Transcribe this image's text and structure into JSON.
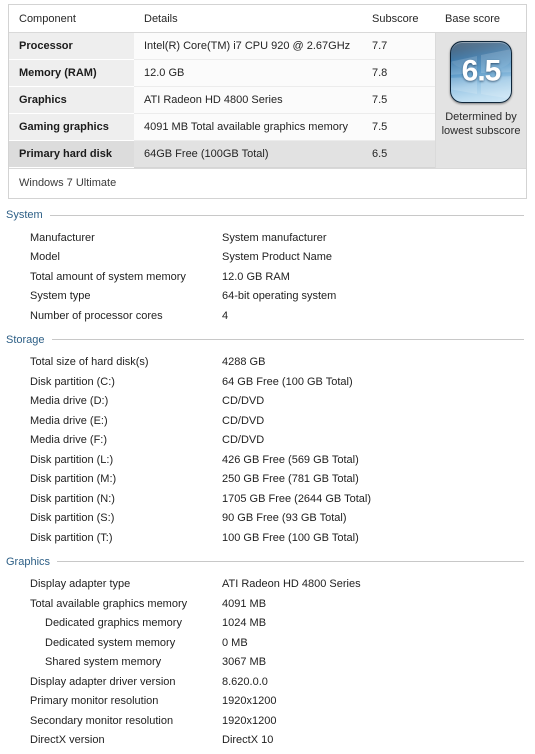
{
  "wei_table": {
    "headers": [
      "Component",
      "Details",
      "Subscore",
      "Base score"
    ],
    "rows": [
      {
        "component": "Processor",
        "details": "Intel(R) Core(TM) i7 CPU 920 @ 2.67GHz",
        "subscore": "7.7",
        "lowest": false
      },
      {
        "component": "Memory (RAM)",
        "details": "12.0 GB",
        "subscore": "7.8",
        "lowest": false
      },
      {
        "component": "Graphics",
        "details": "ATI Radeon HD 4800 Series",
        "subscore": "7.5",
        "lowest": false
      },
      {
        "component": "Gaming graphics",
        "details": "4091 MB Total available graphics memory",
        "subscore": "7.5",
        "lowest": false
      },
      {
        "component": "Primary hard disk",
        "details": "64GB Free (100GB Total)",
        "subscore": "6.5",
        "lowest": true
      }
    ],
    "base_score": "6.5",
    "base_score_caption": "Determined by lowest subscore",
    "footer": "Windows 7 Ultimate"
  },
  "sections": [
    {
      "title": "System",
      "items": [
        {
          "label": "Manufacturer",
          "value": "System manufacturer",
          "indent": false
        },
        {
          "label": "Model",
          "value": "System Product Name",
          "indent": false
        },
        {
          "label": "Total amount of system memory",
          "value": "12.0 GB RAM",
          "indent": false
        },
        {
          "label": "System type",
          "value": "64-bit operating system",
          "indent": false
        },
        {
          "label": "Number of processor cores",
          "value": "4",
          "indent": false
        }
      ]
    },
    {
      "title": "Storage",
      "items": [
        {
          "label": "Total size of hard disk(s)",
          "value": "4288 GB",
          "indent": false
        },
        {
          "label": "Disk partition (C:)",
          "value": "64 GB Free (100 GB Total)",
          "indent": false
        },
        {
          "label": "Media drive (D:)",
          "value": "CD/DVD",
          "indent": false
        },
        {
          "label": "Media drive (E:)",
          "value": "CD/DVD",
          "indent": false
        },
        {
          "label": "Media drive (F:)",
          "value": "CD/DVD",
          "indent": false
        },
        {
          "label": "Disk partition (L:)",
          "value": "426 GB Free (569 GB Total)",
          "indent": false
        },
        {
          "label": "Disk partition (M:)",
          "value": "250 GB Free (781 GB Total)",
          "indent": false
        },
        {
          "label": "Disk partition (N:)",
          "value": "1705 GB Free (2644 GB Total)",
          "indent": false
        },
        {
          "label": "Disk partition (S:)",
          "value": "90 GB Free (93 GB Total)",
          "indent": false
        },
        {
          "label": "Disk partition (T:)",
          "value": "100 GB Free (100 GB Total)",
          "indent": false
        }
      ]
    },
    {
      "title": "Graphics",
      "items": [
        {
          "label": "Display adapter type",
          "value": "ATI Radeon HD 4800 Series",
          "indent": false
        },
        {
          "label": "Total available graphics memory",
          "value": "4091 MB",
          "indent": false
        },
        {
          "label": "Dedicated graphics memory",
          "value": "1024 MB",
          "indent": true
        },
        {
          "label": "Dedicated system memory",
          "value": "0 MB",
          "indent": true
        },
        {
          "label": "Shared system memory",
          "value": "3067 MB",
          "indent": true
        },
        {
          "label": "Display adapter driver version",
          "value": "8.620.0.0",
          "indent": false
        },
        {
          "label": "Primary monitor resolution",
          "value": "1920x1200",
          "indent": false
        },
        {
          "label": "Secondary monitor resolution",
          "value": "1920x1200",
          "indent": false
        },
        {
          "label": "DirectX version",
          "value": "DirectX 10",
          "indent": false
        }
      ]
    }
  ],
  "colors": {
    "section_title": "#2d5f86",
    "badge_dark": "#15334f",
    "badge_light": "#cfe7f6",
    "row_alt": "#eeeeee",
    "lowest_highlight": "#e2e2e2"
  }
}
